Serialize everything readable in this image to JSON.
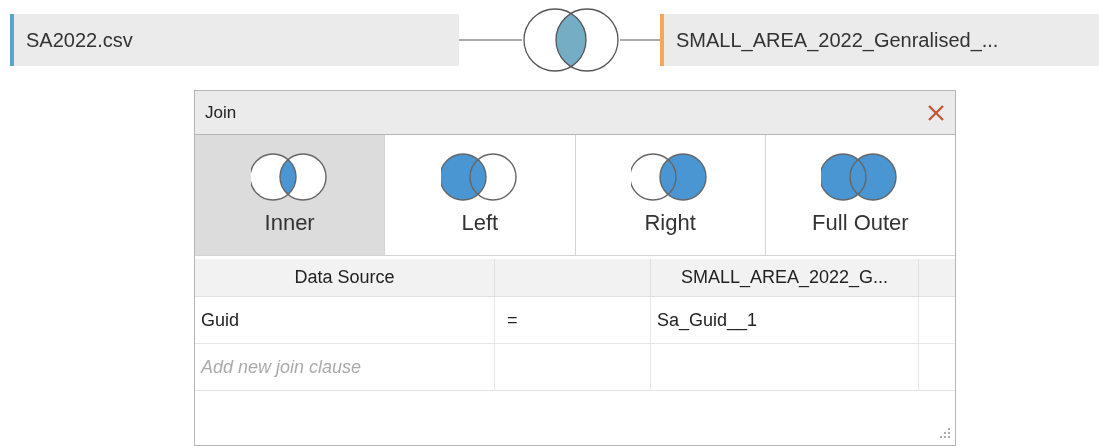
{
  "tables": [
    {
      "name": "SA2022.csv",
      "color": "#5ba3c9"
    },
    {
      "name": "SMALL_AREA_2022_Genralised_...",
      "color": "#f5a85a"
    }
  ],
  "join_link": {
    "kind": "inner"
  },
  "join_dialog": {
    "title": "Join",
    "join_types": [
      {
        "label": "Inner",
        "kind": "inner",
        "selected": true
      },
      {
        "label": "Left",
        "kind": "left",
        "selected": false
      },
      {
        "label": "Right",
        "kind": "right",
        "selected": false
      },
      {
        "label": "Full Outer",
        "kind": "full",
        "selected": false
      }
    ],
    "clause_table": {
      "left_column": "Data Source",
      "right_column": "SMALL_AREA_2022_G...",
      "rows": [
        {
          "left": "Guid",
          "operator": "=",
          "right": "Sa_Guid__1"
        }
      ],
      "new_clause_placeholder": "Add new join clause"
    }
  }
}
